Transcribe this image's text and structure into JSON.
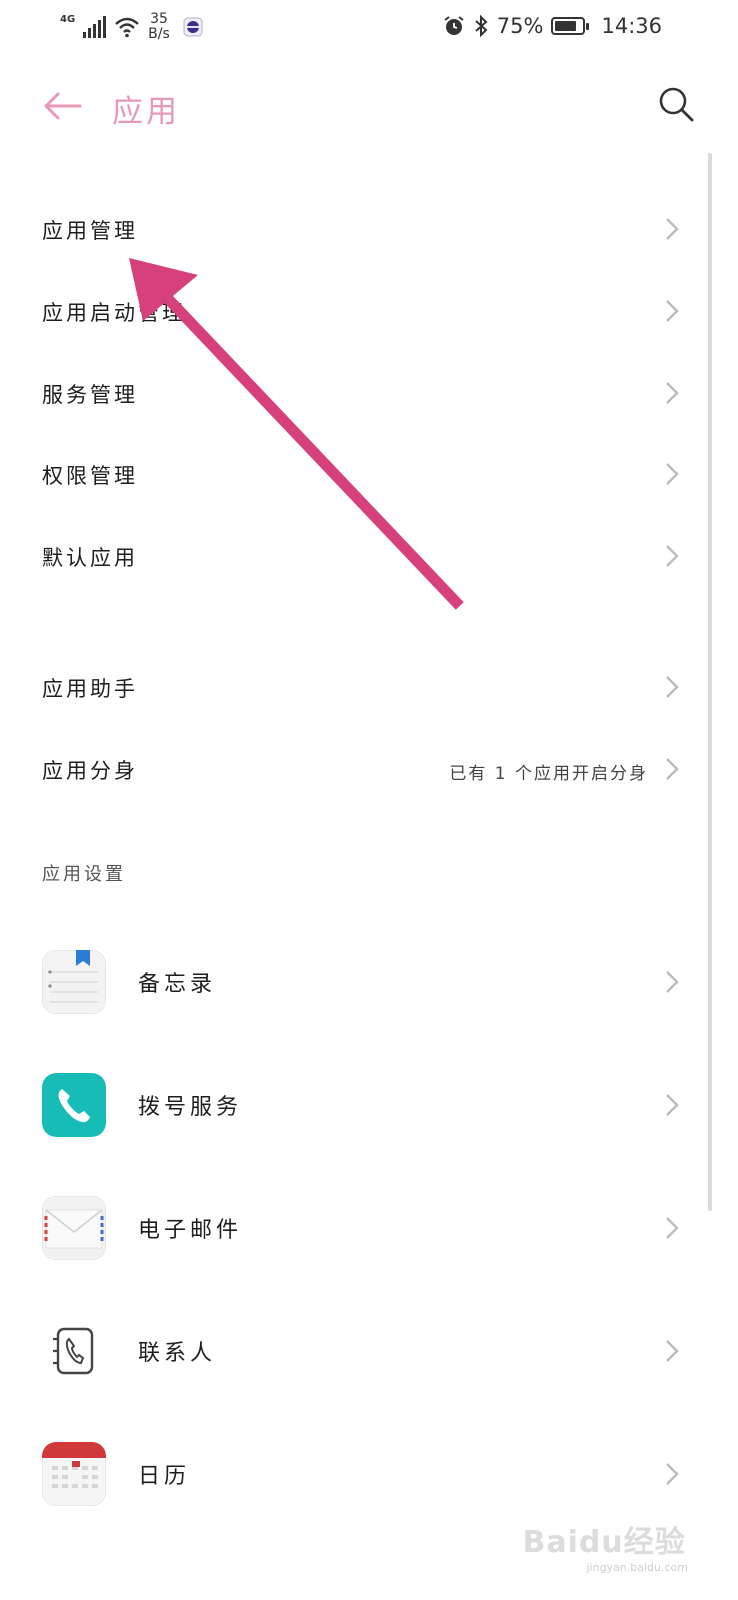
{
  "status_bar": {
    "network": "4G",
    "speed_value": "35",
    "speed_unit": "B/s",
    "battery": "75%",
    "time": "14:36"
  },
  "header": {
    "title": "应用"
  },
  "menu": [
    {
      "label": "应用管理"
    },
    {
      "label": "应用启动管理"
    },
    {
      "label": "服务管理"
    },
    {
      "label": "权限管理"
    },
    {
      "label": "默认应用"
    }
  ],
  "menu2": [
    {
      "label": "应用助手",
      "value": ""
    },
    {
      "label": "应用分身",
      "value": "已有 1 个应用开启分身"
    }
  ],
  "app_settings": {
    "title": "应用设置",
    "apps": [
      {
        "label": "备忘录",
        "icon": "notepad-icon"
      },
      {
        "label": "拨号服务",
        "icon": "phone-icon"
      },
      {
        "label": "电子邮件",
        "icon": "mail-icon"
      },
      {
        "label": "联系人",
        "icon": "contacts-icon"
      },
      {
        "label": "日历",
        "icon": "calendar-icon"
      }
    ]
  },
  "colors": {
    "title_accent": "#e79ab1",
    "annotation_arrow": "#d6407b"
  },
  "watermark": {
    "main": "Baidu经验",
    "sub": "jingyan.baidu.com"
  }
}
